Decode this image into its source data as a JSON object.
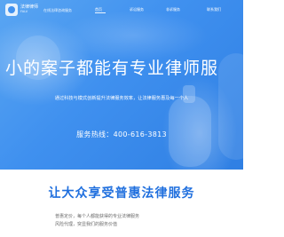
{
  "brand": {
    "logo_title": "法律律师",
    "logo_sub": "FALV",
    "slogan": "在线法律咨询服务"
  },
  "nav": {
    "items": [
      {
        "label": "首页"
      },
      {
        "label": "诉讼服务"
      },
      {
        "label": "非诉服务"
      },
      {
        "label": "联系我们"
      }
    ]
  },
  "hero": {
    "headline": "小的案子都能有专业律师服",
    "subline": "通过科技与模式创新提升法律服务效率，让法律服务惠及每一个人",
    "hotline": "服务热线：400-616-3813"
  },
  "section": {
    "title": "让大众享受普惠法律服务",
    "features": [
      "普惠定价，每个人都能获得的专业法律服务",
      "风险代理，突显我们的服务价值"
    ]
  },
  "colors": {
    "hero_blue": "#3f90ef",
    "accent_blue": "#1f6fde"
  }
}
